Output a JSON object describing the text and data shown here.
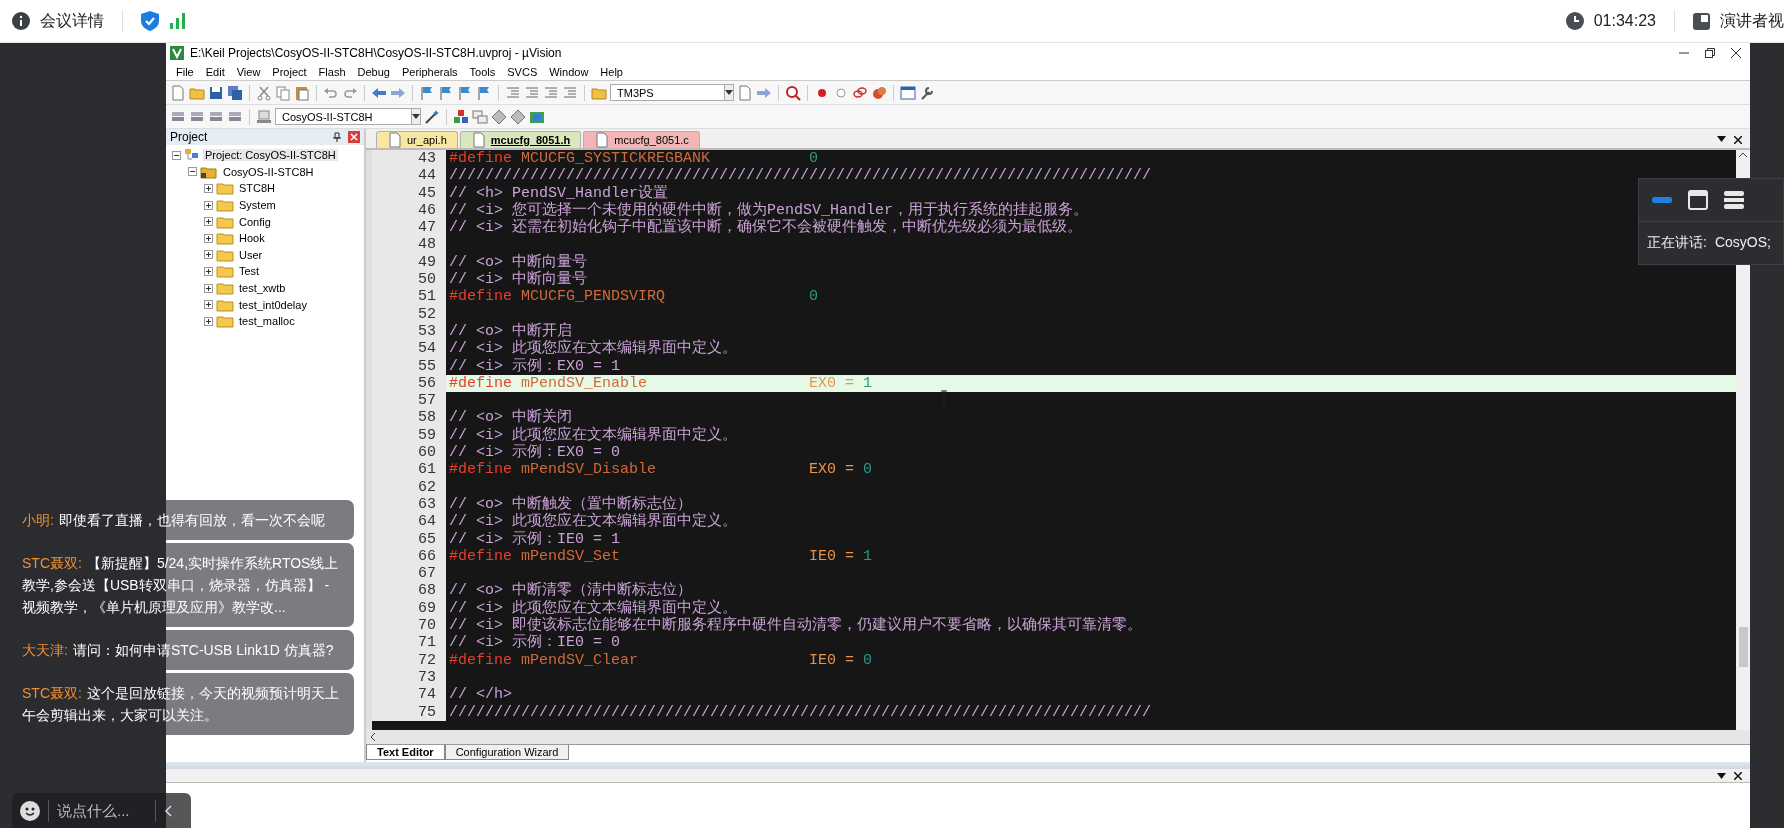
{
  "top_bar": {
    "meeting_label": "会议详情",
    "timer": "01:34:23",
    "view_label": "演讲者视"
  },
  "ide": {
    "title": "E:\\Keil Projects\\CosyOS-II-STC8H\\CosyOS-II-STC8H.uvproj - µVision",
    "menu": [
      "File",
      "Edit",
      "View",
      "Project",
      "Flash",
      "Debug",
      "Peripherals",
      "Tools",
      "SVCS",
      "Window",
      "Help"
    ],
    "device_combo": "TM3PS",
    "target_combo": "CosyOS-II-STC8H",
    "project_panel": {
      "title": "Project",
      "tree": [
        {
          "label": "Project: CosyOS-II-STC8H",
          "kind": "project",
          "expanded": true,
          "selected": true,
          "children": [
            {
              "label": "CosyOS-II-STC8H",
              "kind": "target",
              "expanded": true,
              "selected": false,
              "children": [
                {
                  "label": "STC8H",
                  "kind": "group",
                  "expanded": false,
                  "selected": false
                },
                {
                  "label": "System",
                  "kind": "group",
                  "expanded": false,
                  "selected": false
                },
                {
                  "label": "Config",
                  "kind": "group",
                  "expanded": false,
                  "selected": false
                },
                {
                  "label": "Hook",
                  "kind": "group",
                  "expanded": false,
                  "selected": false
                },
                {
                  "label": "User",
                  "kind": "group",
                  "expanded": false,
                  "selected": false
                },
                {
                  "label": "Test",
                  "kind": "group",
                  "expanded": false,
                  "selected": false
                },
                {
                  "label": "test_xwtb",
                  "kind": "group",
                  "expanded": false,
                  "selected": false
                },
                {
                  "label": "test_int0delay",
                  "kind": "group",
                  "expanded": false,
                  "selected": false
                },
                {
                  "label": "test_malloc",
                  "kind": "group",
                  "expanded": false,
                  "selected": false
                }
              ]
            }
          ]
        }
      ]
    },
    "editor_tabs": [
      {
        "label": "ur_api.h",
        "color": "#f7e7a0",
        "selected": false
      },
      {
        "label": "mcucfg_8051.h",
        "color": "#d8e8bc",
        "selected": true
      },
      {
        "label": "mcucfg_8051.c",
        "color": "#f2b6b6",
        "selected": false
      }
    ],
    "code_lines": [
      {
        "number": "43",
        "kind": "define",
        "keyword": "#define",
        "name": "MCUCFG_SYSTICKREGBANK",
        "value": "0",
        "current": false
      },
      {
        "number": "44",
        "kind": "comment",
        "text": "//////////////////////////////////////////////////////////////////////////////",
        "current": false
      },
      {
        "number": "45",
        "kind": "comment",
        "text": "// <h> PendSV_Handler设置",
        "current": false
      },
      {
        "number": "46",
        "kind": "comment",
        "text": "// <i> 您可选择一个未使用的硬件中断，做为PendSV_Handler，用于执行系统的挂起服务。",
        "current": false
      },
      {
        "number": "47",
        "kind": "comment",
        "text": "// <i> 还需在初始化钩子中配置该中断，确保它不会被硬件触发，中断优先级必须为最低级。",
        "current": false
      },
      {
        "number": "48",
        "kind": "blank",
        "current": false
      },
      {
        "number": "49",
        "kind": "comment",
        "text": "// <o> 中断向量号",
        "current": false
      },
      {
        "number": "50",
        "kind": "comment",
        "text": "// <i> 中断向量号",
        "current": false
      },
      {
        "number": "51",
        "kind": "define",
        "keyword": "#define",
        "name": "MCUCFG_PENDSVIRQ",
        "value": "0",
        "current": false
      },
      {
        "number": "52",
        "kind": "blank",
        "current": false
      },
      {
        "number": "53",
        "kind": "comment",
        "text": "// <o> 中断开启",
        "current": false
      },
      {
        "number": "54",
        "kind": "comment",
        "text": "// <i> 此项您应在文本编辑界面中定义。",
        "current": false
      },
      {
        "number": "55",
        "kind": "comment",
        "text": "// <i> 示例：EX0 = 1",
        "current": false
      },
      {
        "number": "56",
        "kind": "define",
        "keyword": "#define",
        "name": "mPendSV_Enable",
        "assign": "EX0 =",
        "value": "1",
        "current": true
      },
      {
        "number": "57",
        "kind": "blank",
        "current": false
      },
      {
        "number": "58",
        "kind": "comment",
        "text": "// <o> 中断关闭",
        "current": false
      },
      {
        "number": "59",
        "kind": "comment",
        "text": "// <i> 此项您应在文本编辑界面中定义。",
        "current": false
      },
      {
        "number": "60",
        "kind": "comment",
        "text": "// <i> 示例：EX0 = 0",
        "current": false
      },
      {
        "number": "61",
        "kind": "define",
        "keyword": "#define",
        "name": "mPendSV_Disable",
        "assign": "EX0 =",
        "value": "0",
        "current": false
      },
      {
        "number": "62",
        "kind": "blank",
        "current": false
      },
      {
        "number": "63",
        "kind": "comment",
        "text": "// <o> 中断触发（置中断标志位）",
        "current": false
      },
      {
        "number": "64",
        "kind": "comment",
        "text": "// <i> 此项您应在文本编辑界面中定义。",
        "current": false
      },
      {
        "number": "65",
        "kind": "comment",
        "text": "// <i> 示例：IE0 = 1",
        "current": false
      },
      {
        "number": "66",
        "kind": "define",
        "keyword": "#define",
        "name": "mPendSV_Set",
        "assign": "IE0 =",
        "value": "1",
        "current": false
      },
      {
        "number": "67",
        "kind": "blank",
        "current": false
      },
      {
        "number": "68",
        "kind": "comment",
        "text": "// <o> 中断清零（清中断标志位）",
        "current": false
      },
      {
        "number": "69",
        "kind": "comment",
        "text": "// <i> 此项您应在文本编辑界面中定义。",
        "current": false
      },
      {
        "number": "70",
        "kind": "comment",
        "text": "// <i> 即使该标志位能够在中断服务程序中硬件自动清零，仍建议用户不要省略，以确保其可靠清零。",
        "current": false
      },
      {
        "number": "71",
        "kind": "comment",
        "text": "// <i> 示例：IE0 = 0",
        "current": false
      },
      {
        "number": "72",
        "kind": "define",
        "keyword": "#define",
        "name": "mPendSV_Clear",
        "assign": "IE0 =",
        "value": "0",
        "current": false
      },
      {
        "number": "73",
        "kind": "blank",
        "current": false
      },
      {
        "number": "74",
        "kind": "comment",
        "text": "// </h>",
        "current": false
      },
      {
        "number": "75",
        "kind": "comment",
        "text": "//////////////////////////////////////////////////////////////////////////////",
        "current": false
      }
    ],
    "bottom_tabs": [
      {
        "label": "Text Editor",
        "selected": true
      },
      {
        "label": "Configuration Wizard",
        "selected": false
      }
    ]
  },
  "speaker_panel": {
    "layouts": [
      {
        "kind": "strip",
        "selected": true
      },
      {
        "kind": "window",
        "selected": false
      },
      {
        "kind": "list",
        "selected": false
      }
    ],
    "label": "正在讲话:",
    "speaker": "CosyOS;"
  },
  "chat": {
    "messages": [
      {
        "author": "小明:",
        "text": "即使看了直播，也得有回放，看一次不会呢"
      },
      {
        "author": "STC聂双:",
        "text": "【新提醒】5/24,实时操作系统RTOS线上教学,参会送【USB转双串口，烧录器，仿真器】 - 视频教学，《单片机原理及应用》教学改..."
      },
      {
        "author": "大天津:",
        "text": "请问：如何申请STC-USB Link1D 仿真器?"
      },
      {
        "author": "STC聂双:",
        "text": "这个是回放链接，今天的视频预计明天上午会剪辑出来，大家可以关注。"
      }
    ],
    "placeholder": "说点什么..."
  }
}
